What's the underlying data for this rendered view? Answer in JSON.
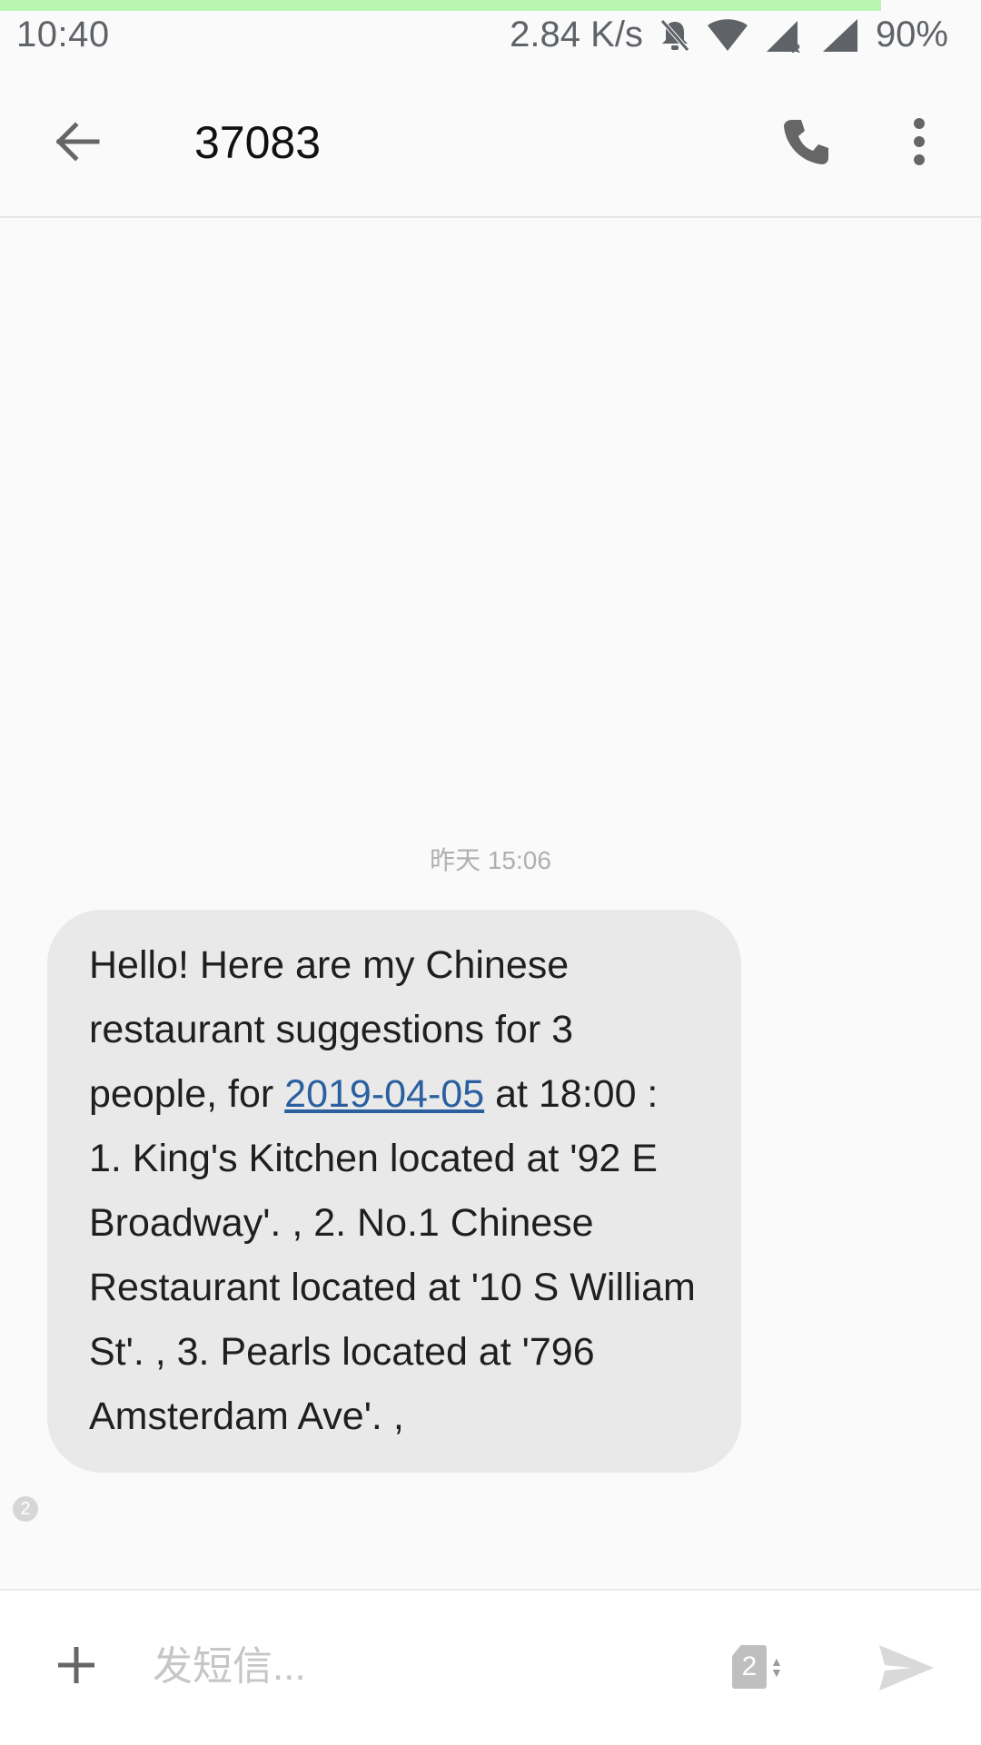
{
  "status_bar": {
    "time": "10:40",
    "network_speed": "2.84 K/s",
    "battery": "90%",
    "icons": [
      "bell-off-icon",
      "wifi-icon",
      "cell-signal-roaming-icon",
      "cell-signal-icon"
    ]
  },
  "header": {
    "back_icon": "arrow-left-icon",
    "title": "37083",
    "call_icon": "phone-icon",
    "more_icon": "more-vertical-icon"
  },
  "conversation": {
    "timestamp": "昨天 15:06",
    "message": {
      "part1": "Hello! Here are my Chinese restaurant suggestions for 3 people, for ",
      "link": "2019-04-05",
      "part2": " at 18:00 :",
      "part3": "1. King's Kitchen located at '92 E Broadway'. , 2. No.1 Chinese Restaurant located at '10 S William St'. , 3. Pearls located at '796 Amsterdam Ave'. ,",
      "sim_badge": "2"
    }
  },
  "composer": {
    "add_icon": "plus-icon",
    "placeholder": "发短信...",
    "sim_label": "2",
    "send_icon": "send-icon"
  },
  "colors": {
    "bubble_bg": "#e9e9e9",
    "link": "#2a5fa0",
    "progress_strip": "#b8f5b0",
    "background": "#fafafa"
  }
}
